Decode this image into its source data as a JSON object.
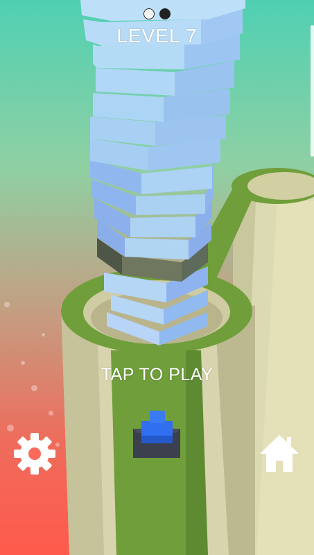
{
  "header": {
    "level_text": "LEVEL 7",
    "progress_dots": [
      {
        "state": "completed",
        "color": "#f4f4f4"
      },
      {
        "state": "current",
        "color": "#222222"
      }
    ]
  },
  "prompt": {
    "tap_to_play": "TAP TO PLAY"
  },
  "controls": {
    "settings_icon": "gear-icon",
    "home_icon": "home-icon"
  },
  "colors": {
    "background_top": "#4fd0b3",
    "background_bottom": "#ff5a4c",
    "stack_blocks": "#a6d4f1",
    "dark_block": "#6f775f",
    "pillar": "#d7d6b2",
    "grass": "#6f9e3a",
    "player": "#2f6ff0"
  }
}
